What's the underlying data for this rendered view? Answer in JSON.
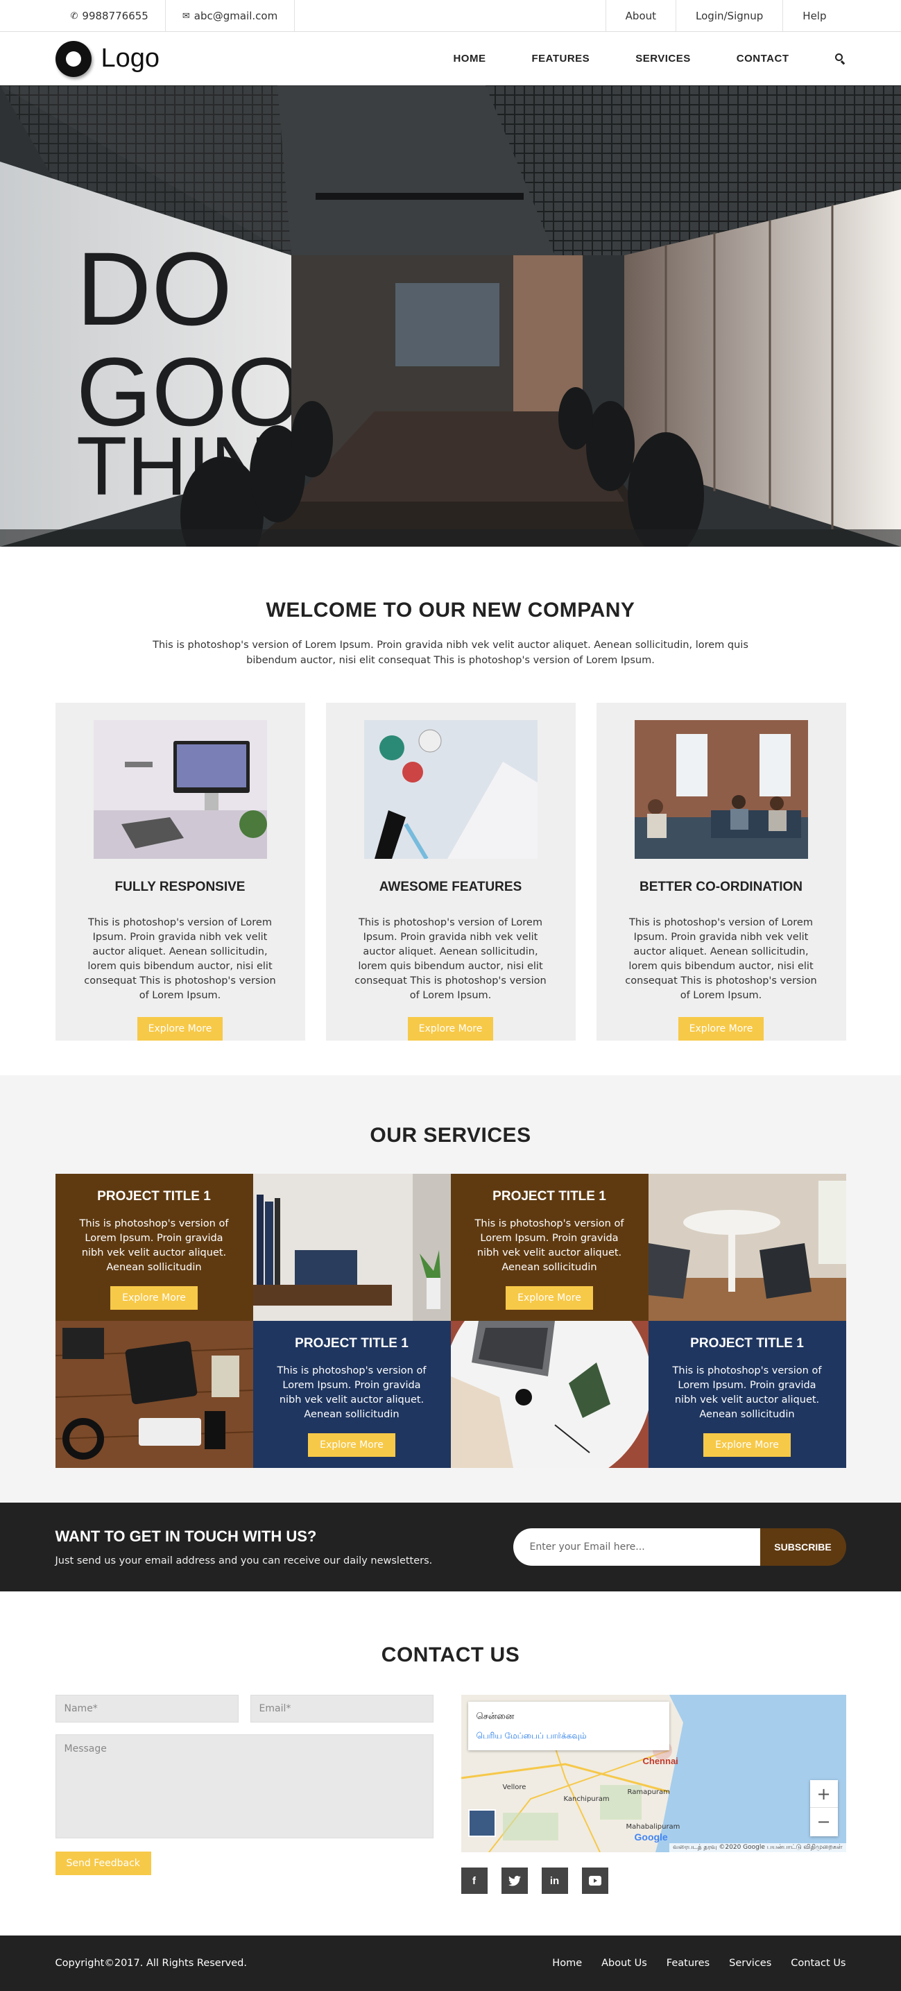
{
  "topbar": {
    "phone": "9988776655",
    "email": "abc@gmail.com",
    "links": [
      "About",
      "Login/Signup",
      "Help"
    ]
  },
  "nav": {
    "logo": "Logo",
    "links": [
      "HOME",
      "FEATURES",
      "SERVICES",
      "CONTACT"
    ]
  },
  "hero": {
    "wall_text": [
      "DO",
      "GOOD",
      "THINGS"
    ]
  },
  "welcome": {
    "title": "WELCOME TO OUR NEW COMPANY",
    "intro": "This is photoshop's version of Lorem Ipsum. Proin gravida nibh vek velit auctor aliquet. Aenean sollicitudin, lorem quis bibendum auctor, nisi elit consequat This is photoshop's version of Lorem Ipsum.",
    "cards": [
      {
        "title": "FULLY RESPONSIVE",
        "text": "This is photoshop's version of Lorem Ipsum. Proin gravida nibh vek velit auctor aliquet. Aenean sollicitudin, lorem quis bibendum auctor, nisi elit consequat This is photoshop's version of Lorem Ipsum.",
        "button": "Explore More"
      },
      {
        "title": "AWESOME FEATURES",
        "text": "This is photoshop's version of Lorem Ipsum. Proin gravida nibh vek velit auctor aliquet. Aenean sollicitudin, lorem quis bibendum auctor, nisi elit consequat This is photoshop's version of Lorem Ipsum.",
        "button": "Explore More"
      },
      {
        "title": "BETTER CO-ORDINATION",
        "text": "This is photoshop's version of Lorem Ipsum. Proin gravida nibh vek velit auctor aliquet. Aenean sollicitudin, lorem quis bibendum auctor, nisi elit consequat This is photoshop's version of Lorem Ipsum.",
        "button": "Explore More"
      }
    ]
  },
  "services": {
    "title": "OUR SERVICES",
    "projects": [
      {
        "title": "PROJECT TITLE 1",
        "text": "This is photoshop's version of Lorem Ipsum. Proin gravida nibh vek velit auctor aliquet. Aenean sollicitudin",
        "button": "Explore More"
      },
      {
        "title": "PROJECT TITLE 1",
        "text": "This is photoshop's version of Lorem Ipsum. Proin gravida nibh vek velit auctor aliquet. Aenean sollicitudin",
        "button": "Explore More"
      },
      {
        "title": "PROJECT TITLE 1",
        "text": "This is photoshop's version of Lorem Ipsum. Proin gravida nibh vek velit auctor aliquet. Aenean sollicitudin",
        "button": "Explore More"
      },
      {
        "title": "PROJECT TITLE 1",
        "text": "This is photoshop's version of Lorem Ipsum. Proin gravida nibh vek velit auctor aliquet. Aenean sollicitudin",
        "button": "Explore More"
      }
    ],
    "colors": {
      "brown": "#5f3a11",
      "navy": "#1f3660",
      "accent": "#f7c948"
    }
  },
  "newsletter": {
    "title": "WANT TO GET IN TOUCH WITH US?",
    "subtitle": "Just send us your email address and you can receive our daily newsletters.",
    "placeholder": "Enter your Email here...",
    "button": "SUBSCRIBE"
  },
  "contact": {
    "title": "CONTACT US",
    "name_placeholder": "Name*",
    "email_placeholder": "Email*",
    "message_placeholder": "Message",
    "button": "Send Feedback",
    "map": {
      "city": "சென்னை",
      "link": "பெரிய மேப்பைப் பார்க்கவும்",
      "labels": [
        "Chennai",
        "Vellore",
        "Kanchipuram",
        "Ramapuram",
        "Mahabalipuram"
      ],
      "google": "Google",
      "attribution": "வரைபடத் தரவு ©2020 Google   பயன்பாட்டு விதிமுறைகள்"
    },
    "socials": [
      "f",
      "twitter",
      "in",
      "youtube"
    ]
  },
  "footer": {
    "copyright": "Copyright©2017. All Rights Reserved.",
    "links": [
      "Home",
      "About Us",
      "Features",
      "Services",
      "Contact Us"
    ]
  }
}
